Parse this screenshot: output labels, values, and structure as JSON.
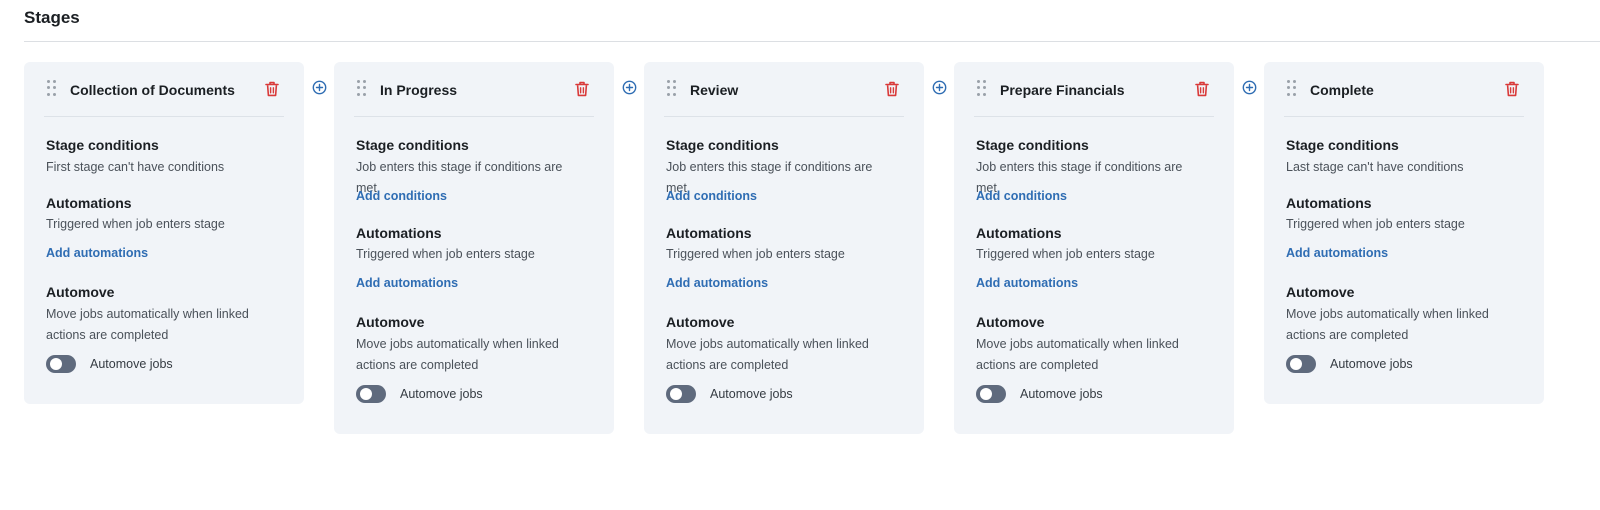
{
  "page": {
    "title": "Stages"
  },
  "colors": {
    "accent": "#2f6db3",
    "danger": "#d93a3a",
    "card": "#f1f4f8",
    "toggle_off": "#5f6a7d"
  },
  "icons": {
    "drag": "drag-handle-icon",
    "delete": "trash-icon",
    "add": "plus-circle-icon"
  },
  "stages": [
    {
      "name": "Collection of Documents",
      "conditions_title": "Stage conditions",
      "conditions_desc": "First stage can't have conditions",
      "add_conditions": null,
      "automations_title": "Automations",
      "automations_desc": "Triggered when job enters stage",
      "add_automations": "Add automations",
      "automove_title": "Automove",
      "automove_desc": "Move jobs automatically when linked actions are completed",
      "automove_toggle_label": "Automove jobs",
      "automove_enabled": false
    },
    {
      "name": "In Progress",
      "conditions_title": "Stage conditions",
      "conditions_desc": "Job enters this stage if conditions are met",
      "add_conditions": "Add conditions",
      "automations_title": "Automations",
      "automations_desc": "Triggered when job enters stage",
      "add_automations": "Add automations",
      "automove_title": "Automove",
      "automove_desc": "Move jobs automatically when linked actions are completed",
      "automove_toggle_label": "Automove jobs",
      "automove_enabled": false
    },
    {
      "name": "Review",
      "conditions_title": "Stage conditions",
      "conditions_desc": "Job enters this stage if conditions are met",
      "add_conditions": "Add conditions",
      "automations_title": "Automations",
      "automations_desc": "Triggered when job enters stage",
      "add_automations": "Add automations",
      "automove_title": "Automove",
      "automove_desc": "Move jobs automatically when linked actions are completed",
      "automove_toggle_label": "Automove jobs",
      "automove_enabled": false
    },
    {
      "name": "Prepare Financials",
      "conditions_title": "Stage conditions",
      "conditions_desc": "Job enters this stage if conditions are met",
      "add_conditions": "Add conditions",
      "automations_title": "Automations",
      "automations_desc": "Triggered when job enters stage",
      "add_automations": "Add automations",
      "automove_title": "Automove",
      "automove_desc": "Move jobs automatically when linked actions are completed",
      "automove_toggle_label": "Automove jobs",
      "automove_enabled": false
    },
    {
      "name": "Complete",
      "conditions_title": "Stage conditions",
      "conditions_desc": "Last stage can't have conditions",
      "add_conditions": null,
      "automations_title": "Automations",
      "automations_desc": "Triggered when job enters stage",
      "add_automations": "Add automations",
      "automove_title": "Automove",
      "automove_desc": "Move jobs automatically when linked actions are completed",
      "automove_toggle_label": "Automove jobs",
      "automove_enabled": false
    }
  ]
}
